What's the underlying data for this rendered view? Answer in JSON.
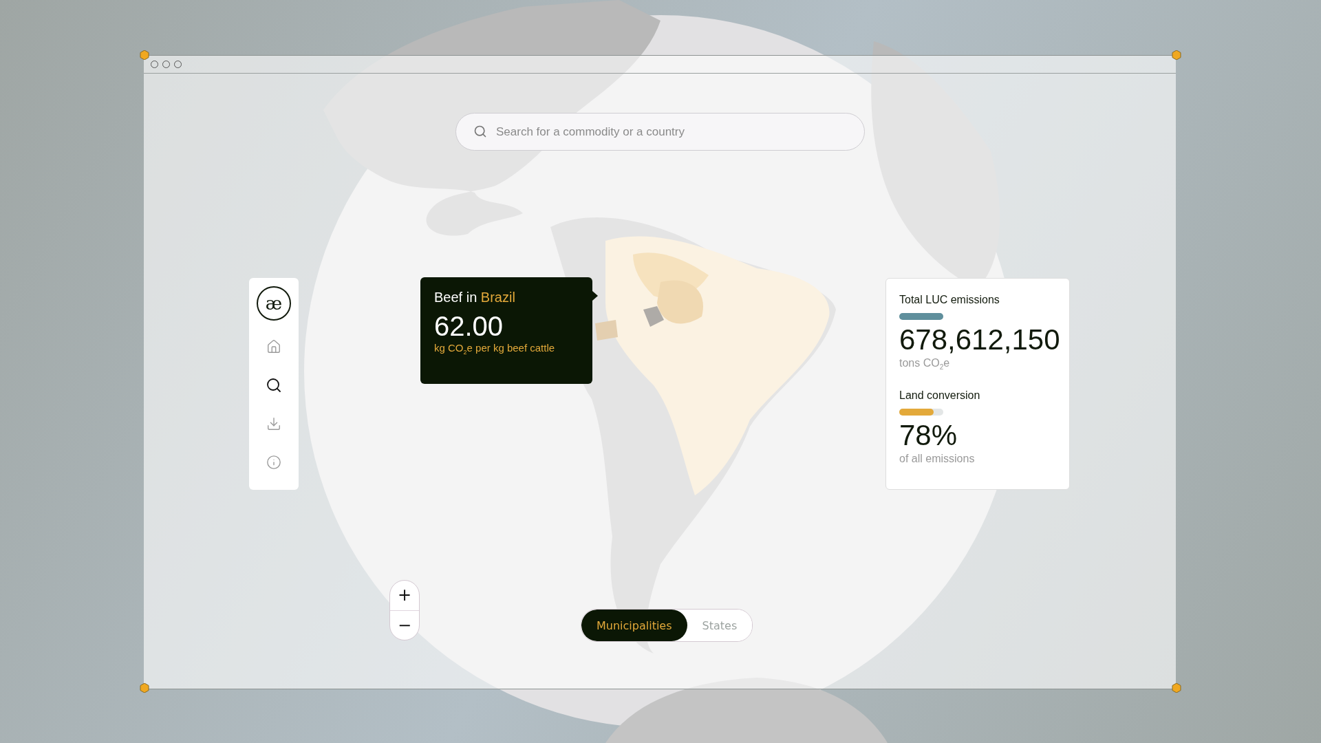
{
  "search": {
    "placeholder": "Search for a commodity or a country"
  },
  "sidebar": {
    "logo": "æ"
  },
  "tooltip": {
    "title": "Beef in",
    "country": "Brazil",
    "value": "62.00",
    "unit": "kg CO$_{2}$e per kg beef cattle"
  },
  "stats": [
    {
      "label": "Total LUC emissions",
      "level": 1,
      "color": "#5f8f9c",
      "value": "678,612,150",
      "unit": "tons CO$_{2}$e"
    },
    {
      "label": "Land conversion",
      "level": 0.78,
      "color": "#e3a93a",
      "value": "78%",
      "unit": "of all emissions"
    }
  ],
  "zoom_controls": [
    "+",
    "−"
  ],
  "view_toggle": [
    {
      "label": "Municipalities",
      "selected": true
    },
    {
      "label": "States",
      "selected": false
    }
  ]
}
